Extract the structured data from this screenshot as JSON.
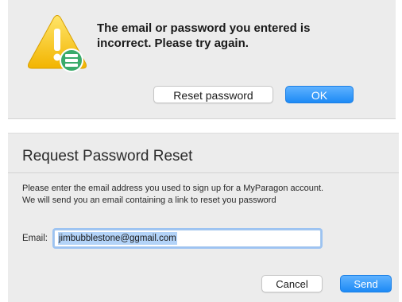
{
  "alert": {
    "message": "The email or password you entered is incorrect. Please try again.",
    "reset_button": "Reset password",
    "ok_button": "OK",
    "icon": "warning-icon",
    "badge_icon": "database-icon"
  },
  "reset_dialog": {
    "title": "Request Password Reset",
    "body_line1": "Please enter the email address you used to sign up for a MyParagon account.",
    "body_line2": "We will send you an email containing a link to reset you password",
    "email_label": "Email:",
    "email_value": "jimbubblestone@ggmail.com",
    "cancel_button": "Cancel",
    "send_button": "Send"
  },
  "colors": {
    "accent": "#1d8af5",
    "warning": "#f5c300",
    "badge": "#3aaa6a"
  }
}
